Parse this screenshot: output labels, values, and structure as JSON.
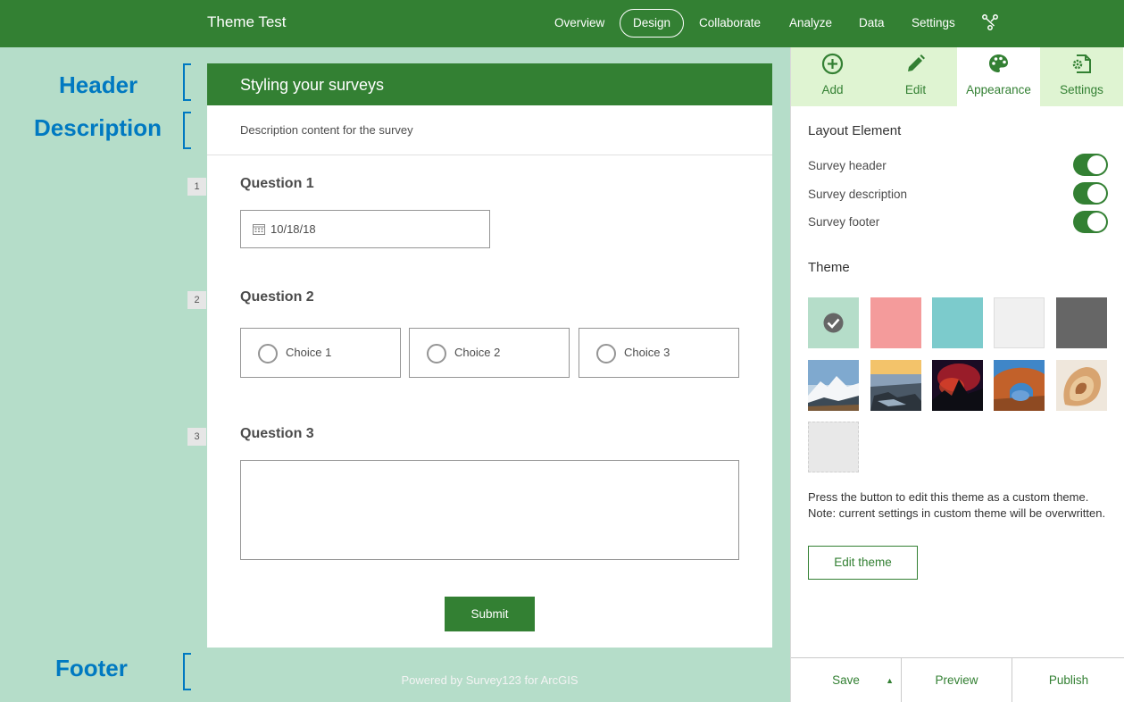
{
  "app": {
    "title": "Theme Test",
    "nav": [
      "Overview",
      "Design",
      "Collaborate",
      "Analyze",
      "Data",
      "Settings"
    ],
    "active_nav": "Design"
  },
  "annotations": {
    "header": "Header",
    "description": "Description",
    "footer": "Footer"
  },
  "survey": {
    "header": "Styling your surveys",
    "description": "Description content for the survey",
    "questions": [
      {
        "number": "1",
        "label": "Question 1",
        "value": "10/18/18"
      },
      {
        "number": "2",
        "label": "Question 2",
        "choices": [
          "Choice 1",
          "Choice 2",
          "Choice 3"
        ]
      },
      {
        "number": "3",
        "label": "Question 3",
        "value": ""
      }
    ],
    "submit_label": "Submit",
    "footer": "Powered by Survey123 for ArcGIS"
  },
  "panel": {
    "tabs": [
      "Add",
      "Edit",
      "Appearance",
      "Settings"
    ],
    "active_tab": "Appearance",
    "layout_title": "Layout Element",
    "toggles": [
      {
        "label": "Survey header",
        "on": true
      },
      {
        "label": "Survey description",
        "on": true
      },
      {
        "label": "Survey footer",
        "on": true
      }
    ],
    "theme_title": "Theme",
    "theme_colors": [
      "#b5ddc9",
      "#f49b9b",
      "#7ccbcc",
      "#f0f0f0",
      "#666666"
    ],
    "selected_theme": 0,
    "theme_images": [
      "snowy-mountain",
      "rocky-shore-sunset",
      "red-aurora-night",
      "rock-arch",
      "seashell"
    ],
    "note": "Press the button to edit this theme as a custom theme. Note: current settings in custom theme will be overwritten.",
    "edit_theme_label": "Edit theme",
    "footer_buttons": [
      "Save",
      "Preview",
      "Publish"
    ]
  },
  "colors": {
    "brand": "#338033",
    "theme_bg": "#b5ddc9",
    "annotation": "#0079c1"
  }
}
